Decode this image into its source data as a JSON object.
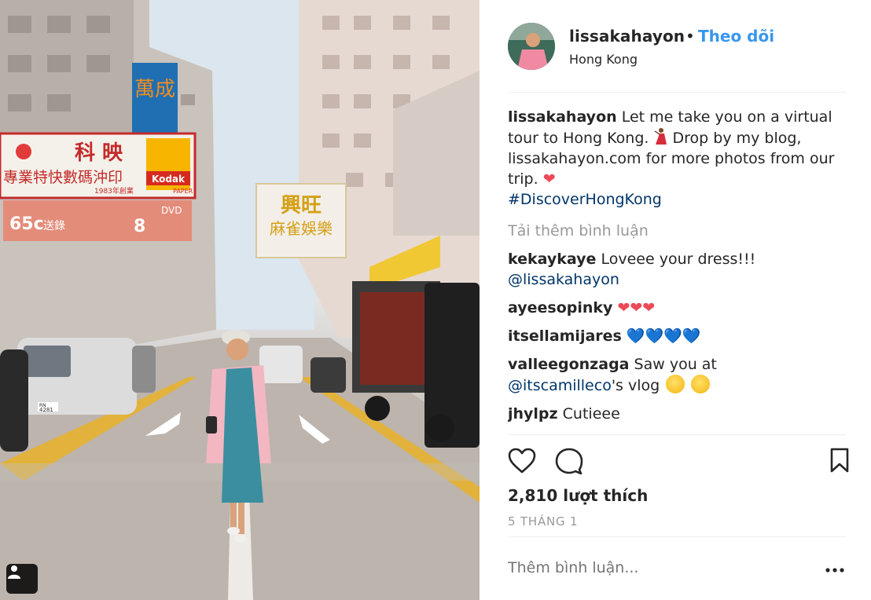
{
  "post": {
    "username": "lissakahayon",
    "separator": "•",
    "follow_label": "Theo dõi",
    "location": "Hong Kong",
    "caption": {
      "username": "lissakahayon",
      "text_1": "Let me take you on a virtual tour to Hong Kong.",
      "text_2": "Drop by my blog, lissakahayon.com for more photos from our trip.",
      "hashtag": "#DiscoverHongKong"
    },
    "load_more_label": "Tải thêm bình luận",
    "comments": [
      {
        "username": "kekaykaye",
        "text": "Loveee your dress!!!",
        "mention": "@lissakahayon"
      },
      {
        "username": "ayeesopinky",
        "emoji": "❤❤❤"
      },
      {
        "username": "itsellamijares",
        "emoji": "💙💙💙💙"
      },
      {
        "username": "valleegonzaga",
        "text": "Saw you at",
        "mention": "@itscamilleco",
        "text_after": "'s vlog"
      },
      {
        "username": "jhylpz",
        "text": "Cutieee"
      }
    ],
    "likes_label": "2,810 lượt thích",
    "date_label": "5 THÁNG 1",
    "add_comment_placeholder": "Thêm bình luận...",
    "icons": {
      "like": "heart-outline-icon",
      "comment": "speech-bubble-icon",
      "save": "bookmark-icon",
      "more": "ellipsis-icon",
      "tagged_user": "person-icon"
    }
  },
  "photo_signs": {
    "sign_top": "萬成",
    "sign_kodak_cn": "科 映",
    "sign_kodak_line": "專業特快數碼沖印",
    "sign_kodak_brand": "Kodak",
    "sign_kodak_year": "1983年創業",
    "sign_kodak_paper": "PAPER",
    "sign_center": "興旺",
    "sign_center_sub": "麻雀娛樂",
    "sign_price": "65c",
    "sign_price_cn": "送錄",
    "sign_dvd": "DVD",
    "sign_dvd_num": "8",
    "plate_1": "RN",
    "plate_2": "4281"
  },
  "colors": {
    "accent": "#3897f0",
    "heart": "#ed4956",
    "text": "#262626",
    "muted": "#999999",
    "link": "#003569"
  }
}
